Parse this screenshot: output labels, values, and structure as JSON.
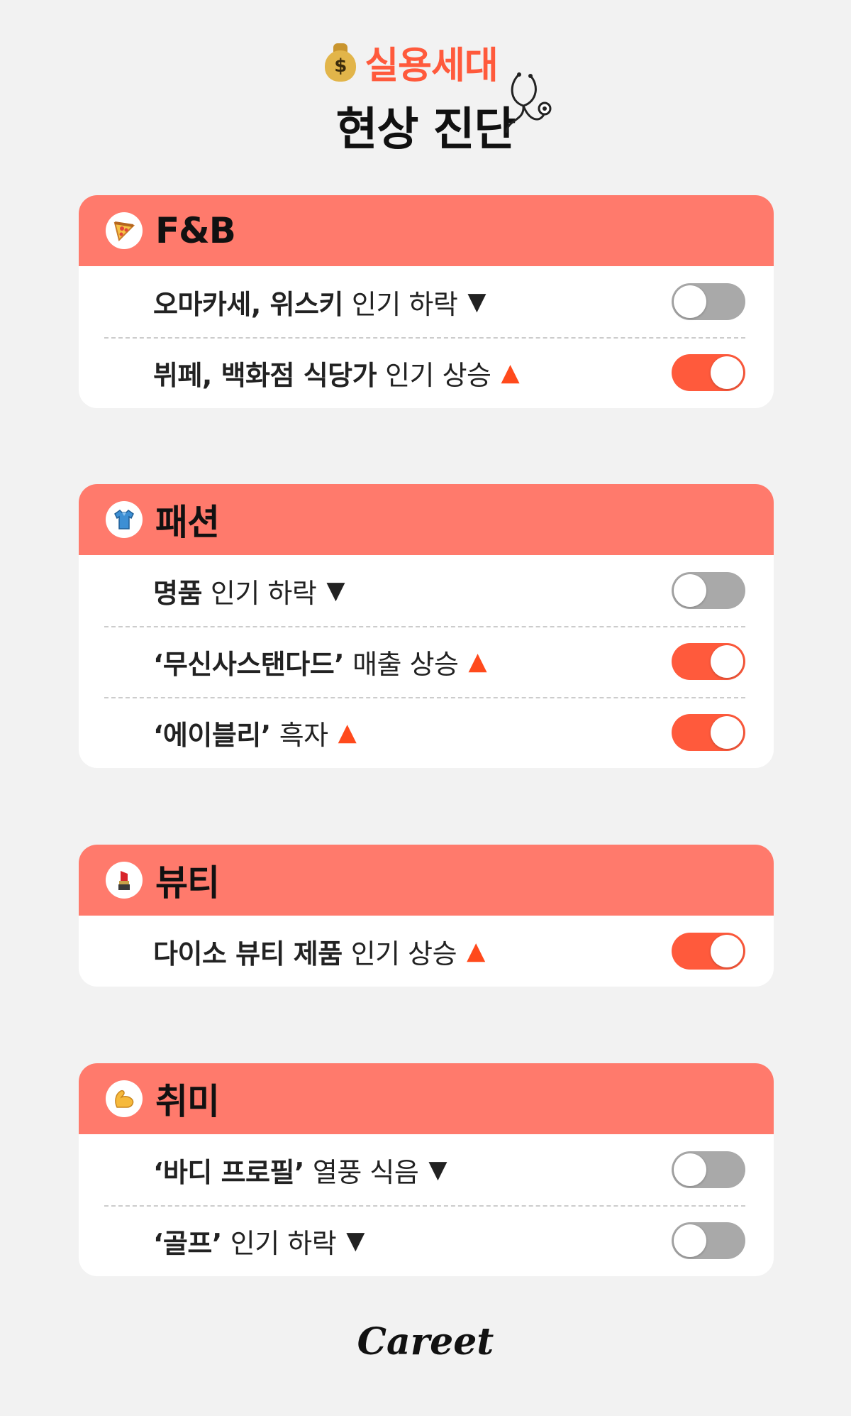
{
  "header": {
    "title_line1": "실용세대",
    "title_line2": "현상 진단",
    "money_symbol": "$"
  },
  "sections": [
    {
      "title": "F&B",
      "icon": "pizza-icon",
      "items": [
        {
          "bold": "오마카세, 위스키",
          "normal": "인기 하락",
          "arrow": "▼",
          "trend": "down",
          "toggle": "off"
        },
        {
          "bold": "뷔페, 백화점 식당가",
          "normal": "인기 상승",
          "arrow": "▲",
          "trend": "up",
          "toggle": "on"
        }
      ]
    },
    {
      "title": "패션",
      "icon": "shirt-icon",
      "items": [
        {
          "bold": "명품",
          "normal": "인기 하락",
          "arrow": "▼",
          "trend": "down",
          "toggle": "off"
        },
        {
          "bold": "‘무신사스탠다드’",
          "normal": "매출 상승",
          "arrow": "▲",
          "trend": "up",
          "toggle": "on"
        },
        {
          "bold": "‘에이블리’",
          "normal": "흑자",
          "arrow": "▲",
          "trend": "up",
          "toggle": "on"
        }
      ]
    },
    {
      "title": "뷰티",
      "icon": "lipstick-icon",
      "items": [
        {
          "bold": "다이소 뷰티 제품",
          "normal": "인기 상승",
          "arrow": "▲",
          "trend": "up",
          "toggle": "on"
        }
      ]
    },
    {
      "title": "취미",
      "icon": "flexed-biceps-icon",
      "items": [
        {
          "bold": "‘바디 프로필’",
          "normal": "열풍 식음",
          "arrow": "▼",
          "trend": "down",
          "toggle": "off"
        },
        {
          "bold": "‘골프’",
          "normal": "인기 하락",
          "arrow": "▼",
          "trend": "down",
          "toggle": "off"
        }
      ]
    }
  ],
  "footer": {
    "logo": "Careet"
  },
  "colors": {
    "accent": "#ff5a3c",
    "header_band": "#ff7a6c",
    "toggle_off": "#a9a9a9",
    "background": "#f2f2f2"
  }
}
